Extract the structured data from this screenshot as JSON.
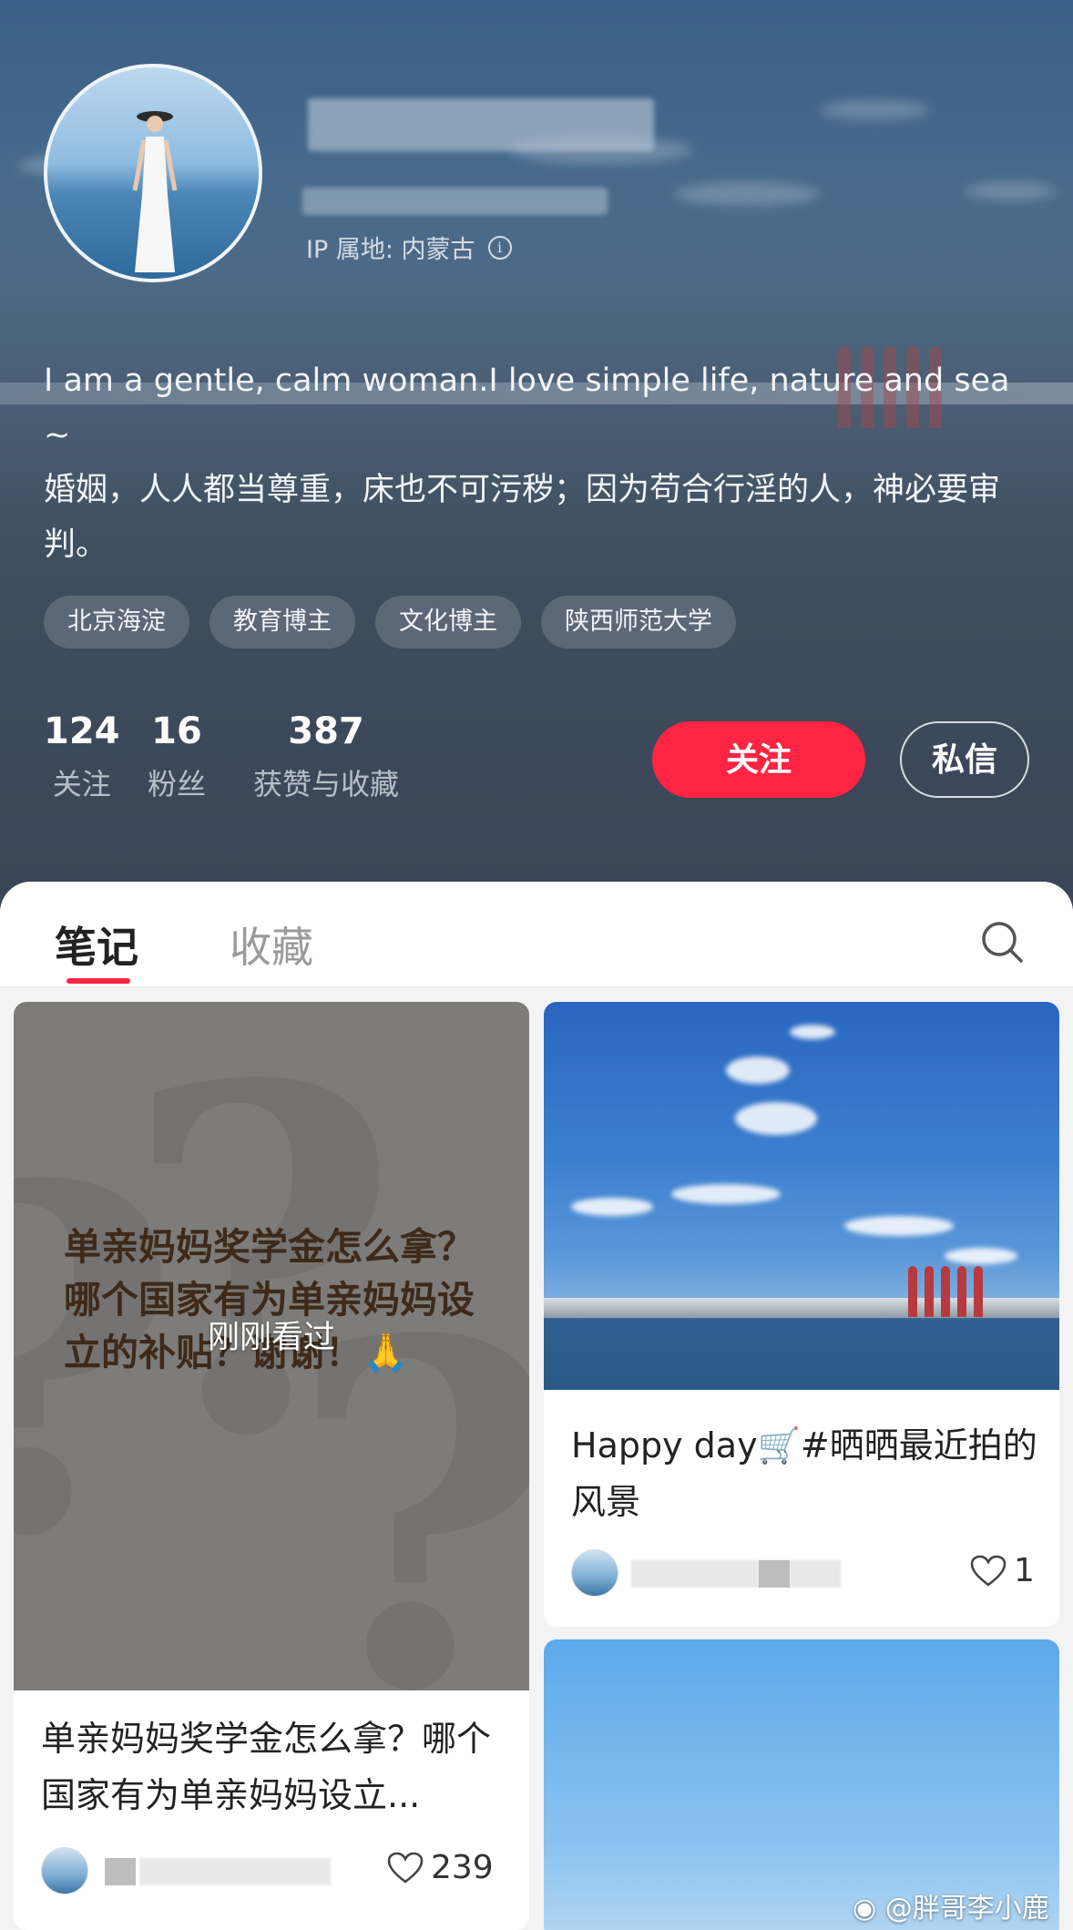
{
  "profile": {
    "ip_location": "IP 属地: 内蒙古",
    "bio_line1": "I am a gentle, calm woman.I love simple life, nature and sea ~",
    "bio_line2": "婚姻，人人都当尊重，床也不可污秽；因为苟合行淫的人，神必要审判。",
    "tags": [
      "北京海淀",
      "教育博主",
      "文化博主",
      "陕西师范大学"
    ],
    "stats": [
      {
        "value": "124",
        "label": "关注"
      },
      {
        "value": "16",
        "label": "粉丝"
      },
      {
        "value": "387",
        "label": "获赞与收藏"
      }
    ],
    "follow_label": "关注",
    "message_label": "私信"
  },
  "tabs": [
    {
      "label": "笔记",
      "active": true
    },
    {
      "label": "收藏",
      "active": false
    }
  ],
  "notes": [
    {
      "cover_text": "单亲妈妈奖学金怎么拿？哪个国家有为单亲妈妈设立的补贴？谢谢！🙏",
      "overlay_label": "刚刚看过",
      "title": "单亲妈妈奖学金怎么拿？哪个国家有为单亲妈妈设立...",
      "likes": "239"
    },
    {
      "title": "Happy day🛒#晒晒最近拍的风景",
      "likes": "1"
    }
  ],
  "watermark": "@胖哥李小鹿",
  "colors": {
    "accent": "#ff2442",
    "header_bg": "#3f4d5e"
  },
  "icons": [
    "info-icon",
    "search-icon",
    "heart-icon",
    "weibo-icon"
  ]
}
